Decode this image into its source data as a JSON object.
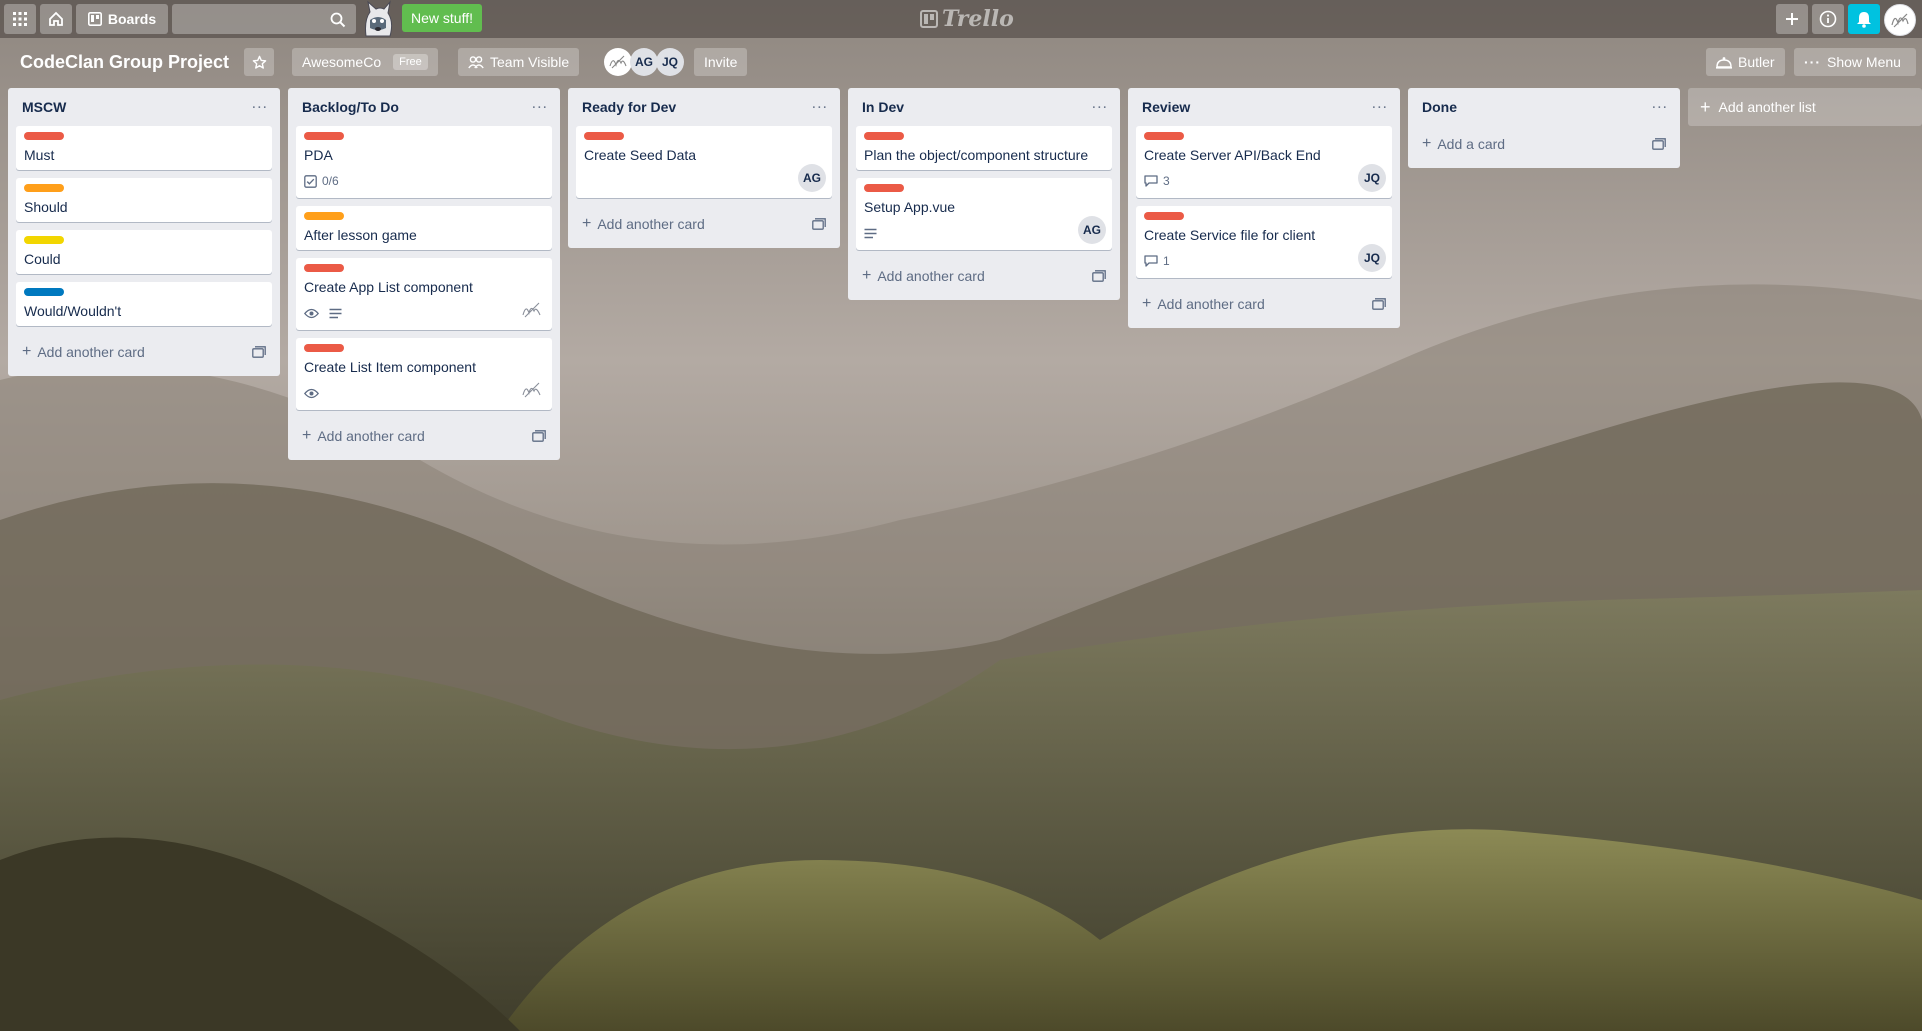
{
  "topbar": {
    "boards_label": "Boards",
    "new_stuff_label": "New stuff!",
    "logo_text": "Trello",
    "icons": [
      "apps-grid-icon",
      "home-icon",
      "boards-icon",
      "search-icon",
      "plus-icon",
      "info-icon",
      "bell-icon"
    ]
  },
  "board": {
    "title": "CodeClan Group Project",
    "team_name": "AwesomeCo",
    "team_badge": "Free",
    "visibility_label": "Team Visible",
    "members": [
      "AG",
      "JQ"
    ],
    "invite_label": "Invite",
    "butler_label": "Butler",
    "show_menu_label": "Show Menu"
  },
  "colors": {
    "red": "#eb5a46",
    "orange": "#ff9f1a",
    "yellow": "#f2d600",
    "blue": "#0079bf",
    "list_bg": "#ebecf0",
    "new_stuff_green": "#61bd4f",
    "notification_cyan": "#00c2e0"
  },
  "lists": [
    {
      "title": "MSCW",
      "cards": [
        {
          "title": "Must",
          "label": "red"
        },
        {
          "title": "Should",
          "label": "orange"
        },
        {
          "title": "Could",
          "label": "yellow"
        },
        {
          "title": "Would/Wouldn't",
          "label": "blue"
        }
      ],
      "add_label": "Add another card"
    },
    {
      "title": "Backlog/To Do",
      "cards": [
        {
          "title": "PDA",
          "label": "red",
          "checklist": "0/6"
        },
        {
          "title": "After lesson game",
          "label": "orange"
        },
        {
          "title": "Create App List component",
          "label": "red",
          "watch": true,
          "description": true,
          "avatar": "sketch"
        },
        {
          "title": "Create List Item component",
          "label": "red",
          "watch": true,
          "avatar": "sketch"
        }
      ],
      "add_label": "Add another card"
    },
    {
      "title": "Ready for Dev",
      "cards": [
        {
          "title": "Create Seed Data",
          "label": "red",
          "avatar": "AG"
        }
      ],
      "add_label": "Add another card"
    },
    {
      "title": "In Dev",
      "cards": [
        {
          "title": "Plan the object/component structure",
          "label": "red"
        },
        {
          "title": "Setup App.vue",
          "label": "red",
          "description": true,
          "avatar": "AG"
        }
      ],
      "add_label": "Add another card"
    },
    {
      "title": "Review",
      "cards": [
        {
          "title": "Create Server API/Back End",
          "label": "red",
          "comments": "3",
          "avatar": "JQ"
        },
        {
          "title": "Create Service file for client",
          "label": "red",
          "comments": "1",
          "avatar": "JQ"
        }
      ],
      "add_label": "Add another card"
    },
    {
      "title": "Done",
      "cards": [],
      "add_label": "Add a card"
    }
  ],
  "add_list_label": "Add another list"
}
